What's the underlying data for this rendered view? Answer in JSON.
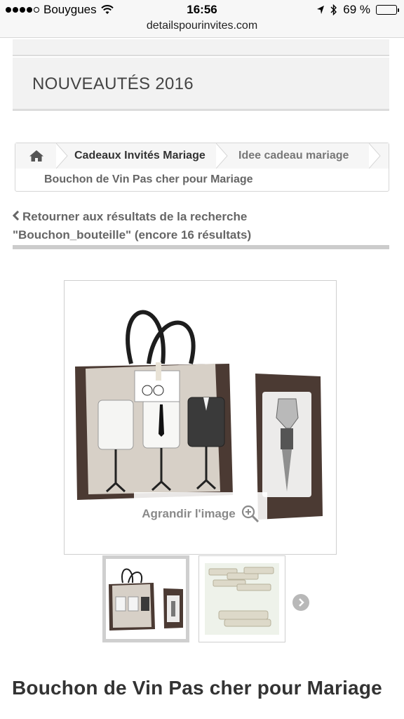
{
  "status_bar": {
    "carrier": "Bouygues",
    "time": "16:56",
    "battery": "69 %",
    "battery_level": 0.69,
    "icons": [
      "signal-dots-icon",
      "wifi-icon",
      "location-arrow-icon",
      "bluetooth-icon",
      "battery-icon"
    ]
  },
  "browser": {
    "url": "detailspourinvites.com"
  },
  "news": {
    "title": "NOUVEAUTÉS 2016"
  },
  "breadcrumb": {
    "home_icon": "home-icon",
    "items": [
      "Cadeaux Invités Mariage",
      "Idee cadeau mariage"
    ],
    "current": "Bouchon de Vin Pas cher pour Mariage"
  },
  "back_link": {
    "icon": "chevron-left-icon",
    "line1": "Retourner aux résultats de la recherche",
    "line2": "\"Bouchon_bouteille\" (encore 16 résultats)"
  },
  "gallery": {
    "zoom_label": "Agrandir l'image",
    "zoom_icon": "zoom-in-icon",
    "next_icon": "chevron-right-icon",
    "thumbnails": [
      "thumbnail-gift-bag-set",
      "thumbnail-clothespins"
    ]
  },
  "product": {
    "title": "Bouchon de Vin Pas cher pour Mariage"
  },
  "colors": {
    "panel_bg": "#f2f2f2",
    "border": "#cfcfcf",
    "text_dark": "#333333",
    "text_muted": "#666666",
    "bag_brown": "#4a3a33"
  }
}
